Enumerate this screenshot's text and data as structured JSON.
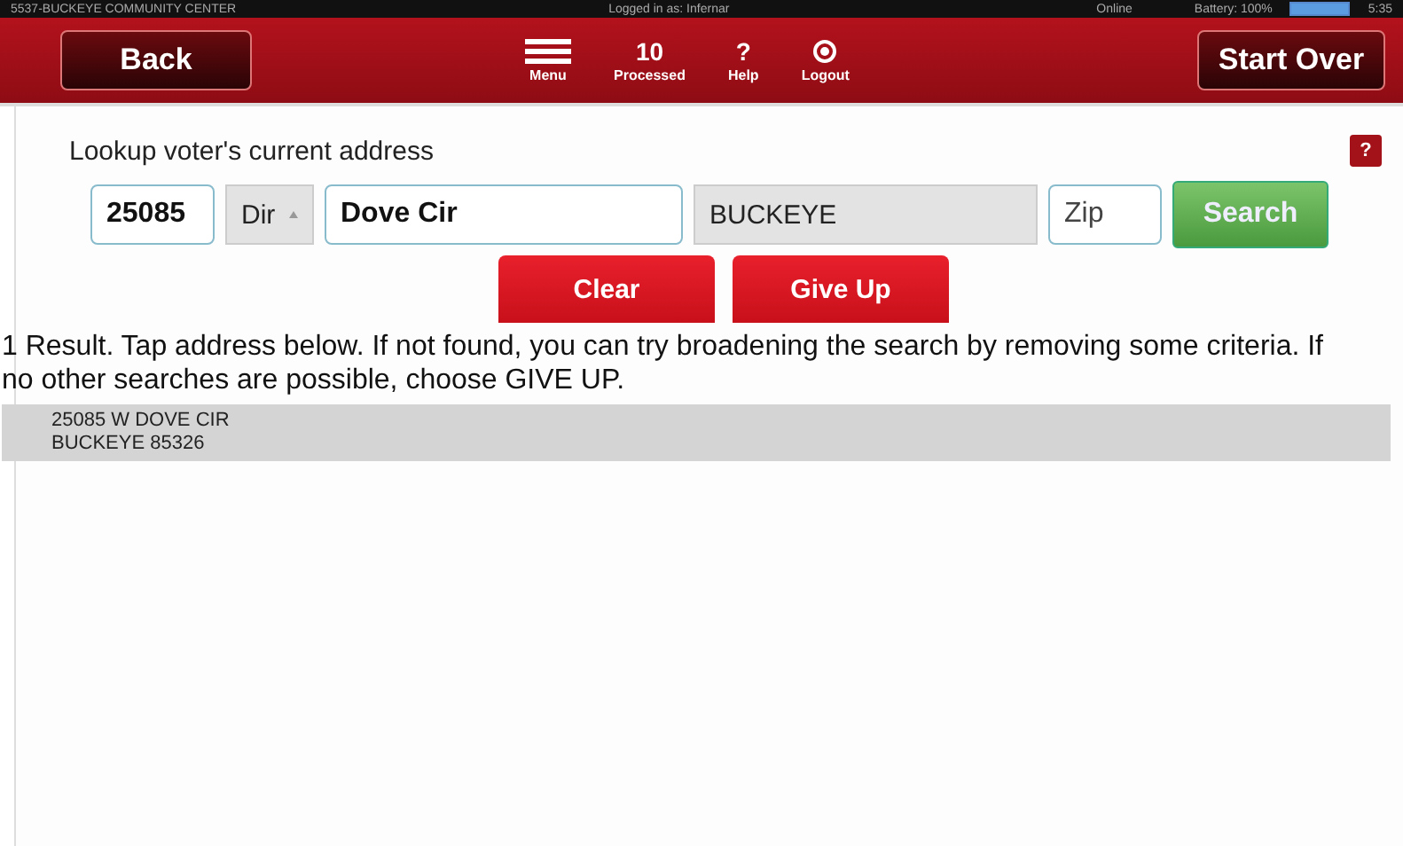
{
  "status_bar": {
    "location": "5537-BUCKEYE COMMUNITY CENTER",
    "user": "Logged in as: Infernar",
    "connection": "Online",
    "battery_label": "Battery: 100%",
    "time": "5:35"
  },
  "header": {
    "back": "Back",
    "menu": "Menu",
    "processed_count": "10",
    "processed_label": "Processed",
    "help_mark": "?",
    "help": "Help",
    "logout": "Logout",
    "start_over": "Start Over"
  },
  "lookup": {
    "title": "Lookup voter's current address",
    "help_mark": "?",
    "house_number": "25085",
    "direction": {
      "placeholder": "Dir"
    },
    "street": "Dove Cir",
    "city": "BUCKEYE",
    "zip": {
      "placeholder": "Zip"
    },
    "search": "Search",
    "clear": "Clear",
    "give_up": "Give Up"
  },
  "message": "1 Result. Tap address below. If not found, you can try broadening the search by removing some criteria. If no other searches are possible, choose GIVE UP.",
  "results": [
    {
      "line1": "25085 W DOVE CIR",
      "line2": "BUCKEYE 85326"
    }
  ]
}
